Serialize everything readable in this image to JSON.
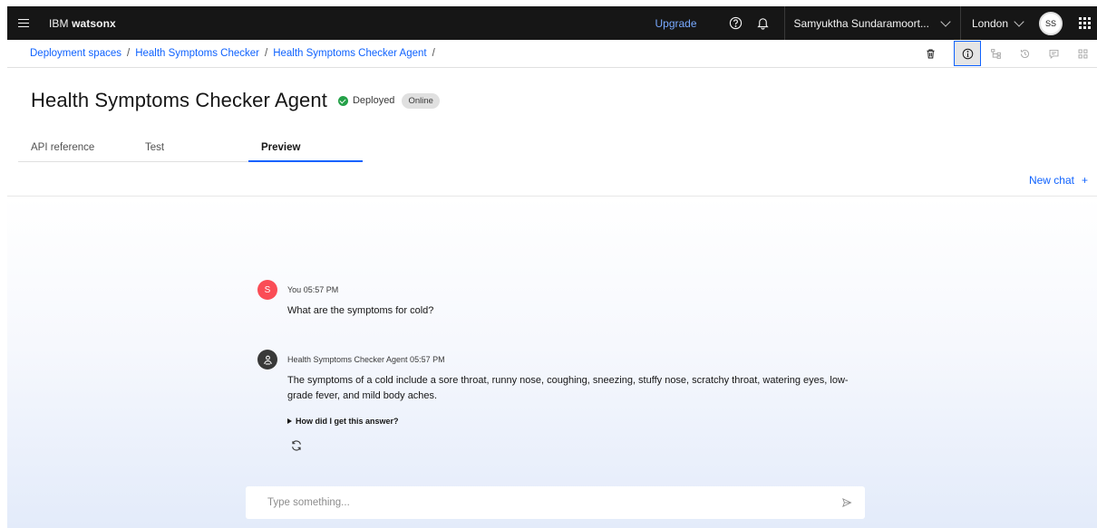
{
  "header": {
    "brand_prefix": "IBM",
    "brand_name": "watsonx",
    "upgrade_label": "Upgrade",
    "account_name": "Samyuktha Sundaramoort...",
    "region": "London",
    "avatar_initials": "SS"
  },
  "breadcrumb": {
    "items": [
      "Deployment spaces",
      "Health Symptoms Checker",
      "Health Symptoms Checker Agent"
    ],
    "separator": "/"
  },
  "page": {
    "title": "Health Symptoms Checker Agent",
    "status": "Deployed",
    "tag": "Online"
  },
  "tabs": [
    {
      "label": "API reference"
    },
    {
      "label": "Test"
    },
    {
      "label": "Preview"
    }
  ],
  "new_chat_label": "New chat",
  "new_chat_plus": "+",
  "chat": {
    "messages": [
      {
        "avatar": "S",
        "meta": "You 05:57 PM",
        "text": "What are the symptoms for cold?"
      },
      {
        "avatar": "agent-icon",
        "meta": "Health Symptoms Checker Agent 05:57 PM",
        "text": "The symptoms of a cold include a sore throat, runny nose, coughing, sneezing, stuffy nose, scratchy throat, watering eyes, low-grade fever, and mild body aches.",
        "explain_label": "How did I get this answer?"
      }
    ],
    "input_placeholder": "Type something...",
    "input_value": ""
  },
  "icons": {
    "menu": "hamburger-icon",
    "help": "help-icon",
    "notifications": "bell-icon",
    "switcher": "app-switcher-icon",
    "delete": "trash-icon",
    "info": "info-icon",
    "send": "send-icon",
    "regenerate": "regenerate-icon"
  },
  "colors": {
    "accent": "#0f62fe",
    "success": "#24a148",
    "user_avatar": "#fa4d56",
    "topbar": "#161616"
  }
}
